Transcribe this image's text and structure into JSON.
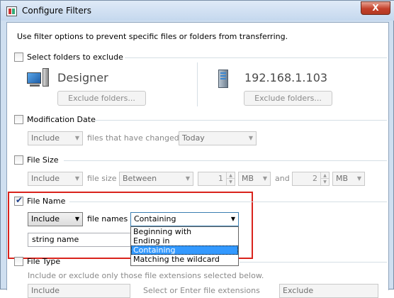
{
  "window": {
    "title": "Configure Filters",
    "close_glyph": "X"
  },
  "intro": "Use filter options to prevent specific files or folders from transferring.",
  "folders": {
    "label": "Select folders to exclude",
    "checked": false,
    "local_name": "Designer",
    "local_icon": "computer-icon",
    "local_button": "Exclude folders...",
    "remote_name": "192.168.1.103",
    "remote_icon": "server-icon",
    "remote_button": "Exclude folders..."
  },
  "modification": {
    "label": "Modification Date",
    "checked": false,
    "mode": "Include",
    "text": "files that have changed",
    "when": "Today"
  },
  "file_size": {
    "label": "File Size",
    "checked": false,
    "mode": "Include",
    "text": "file size",
    "operator": "Between",
    "min_value": "1",
    "min_unit": "MB",
    "and_text": "and",
    "max_value": "2",
    "max_unit": "MB"
  },
  "file_name": {
    "label": "File Name",
    "checked": true,
    "mode": "Include",
    "text": "file names",
    "match": "Containing",
    "value": "string name",
    "options": [
      "Beginning with",
      "Ending in",
      "Containing",
      "Matching the wildcard"
    ],
    "selected_option": "Containing"
  },
  "file_type": {
    "label": "File Type",
    "checked": false,
    "description": "Include or exclude only those file extensions selected below.",
    "partial_left": "Include",
    "partial_mid": "Select or Enter file extensions",
    "partial_right": "Exclude"
  },
  "colors": {
    "highlight": "#d9231c",
    "selection": "#3399ff"
  }
}
